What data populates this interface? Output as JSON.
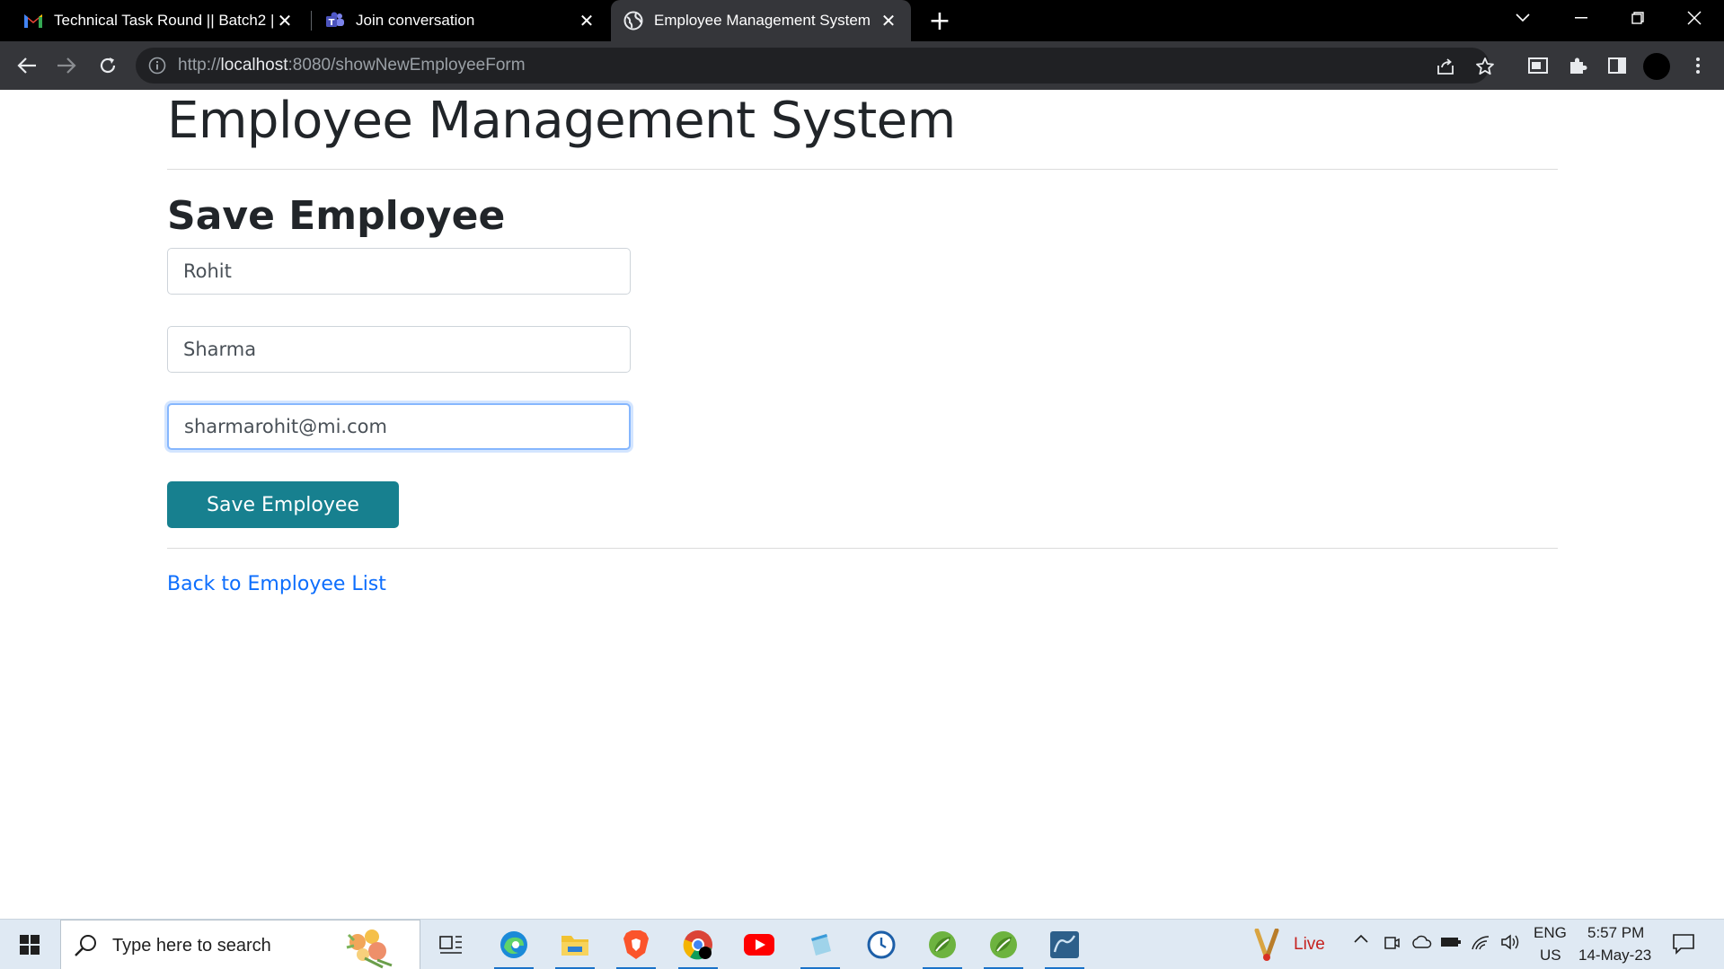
{
  "browser": {
    "tabs": [
      {
        "title": "Technical Task Round || Batch2 || ",
        "icon": "gmail-icon",
        "active": false
      },
      {
        "title": "Join conversation",
        "icon": "teams-icon",
        "active": false
      },
      {
        "title": "Employee Management System",
        "icon": "globe-icon",
        "active": true
      }
    ],
    "url_prefix": "http://",
    "url_host": "localhost",
    "url_rest": ":8080/showNewEmployeeForm"
  },
  "page": {
    "app_title": "Employee Management System",
    "form_title": "Save Employee",
    "fields": {
      "first_name": "Rohit",
      "last_name": "Sharma",
      "email": "sharmarohit@mi.com"
    },
    "save_label": "Save Employee",
    "back_link": "Back to Employee List"
  },
  "taskbar": {
    "search_placeholder": "Type here to search",
    "weather_label": "Live",
    "language": "ENG",
    "region": "US",
    "time": "5:57 PM",
    "date": "14-May-23"
  },
  "colors": {
    "primary_button": "#17808f",
    "link": "#0d6efd",
    "title_text": "#212529"
  }
}
